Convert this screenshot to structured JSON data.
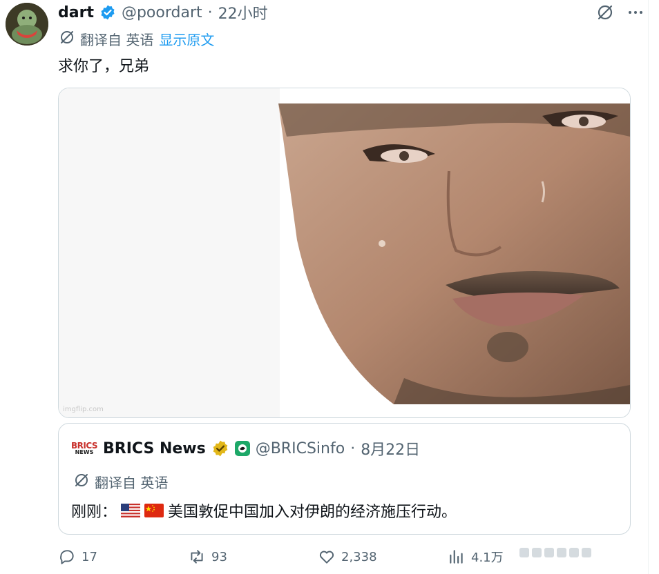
{
  "tweet": {
    "name": "dart",
    "handle": "@poordart",
    "separator": "·",
    "time": "22小时",
    "translated_from": "翻译自 英语",
    "show_original": "显示原文",
    "text": "求你了，兄弟",
    "media_watermark": "imgflip.com"
  },
  "quoted": {
    "logo_top": "BRICS",
    "logo_bottom": "NEWS",
    "name": "BRICS News",
    "handle": "@BRICSinfo",
    "separator": "·",
    "date": "8月22日",
    "translated_from": "翻译自 英语",
    "text_prefix": "刚刚：",
    "text_body": "美国敦促中国加入对伊朗的经济施压行动。"
  },
  "actions": {
    "replies": "17",
    "retweets": "93",
    "likes": "2,338",
    "views": "4.1万"
  },
  "colors": {
    "accent": "#1d9bf0",
    "muted": "#536471",
    "border": "#cfd9de",
    "verified_blue": "#1d9bf0",
    "gold": "#e2b719"
  }
}
